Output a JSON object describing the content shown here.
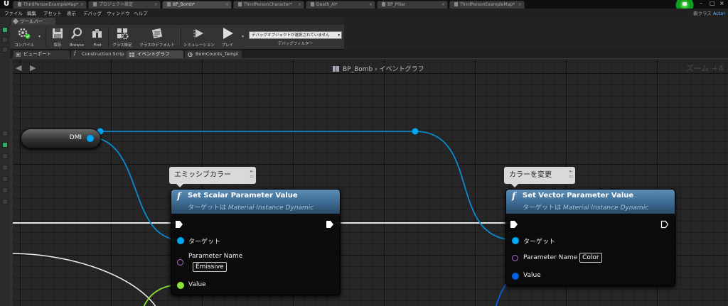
{
  "doc_tabs": [
    {
      "label": "ThirdPersonExampleMap*",
      "active": false
    },
    {
      "label": "プロジェクト設定",
      "active": false
    },
    {
      "label": "BP_Bomb*",
      "active": true
    },
    {
      "label": "ThirdPersonCharacter*",
      "active": false
    },
    {
      "label": "Death_AI*",
      "active": false
    },
    {
      "label": "BP_Pillar",
      "active": false
    },
    {
      "label": "ThirdPersonExampleMap*",
      "active": false
    }
  ],
  "menu": [
    "ファイル",
    "編集",
    "アセット",
    "表示",
    "デバッグ",
    "ウィンドウ",
    "ヘルプ"
  ],
  "parent_class": {
    "label": "親クラス",
    "value": "Actor"
  },
  "toolbar": {
    "tab_label": "ツールバー",
    "buttons": [
      {
        "label": "コンパイル",
        "icon": "compile-icon"
      },
      {
        "label": "保存",
        "icon": "save-icon"
      },
      {
        "label": "Browse",
        "icon": "browse-icon"
      },
      {
        "label": "Find",
        "icon": "find-icon"
      },
      {
        "label": "クラス設定",
        "icon": "class-settings-icon"
      },
      {
        "label": "クラスのデフォルト",
        "icon": "class-defaults-icon"
      },
      {
        "label": "シミュレーション",
        "icon": "simulation-icon"
      },
      {
        "label": "プレイ",
        "icon": "play-icon"
      }
    ],
    "debug_select": "デバッグオブジェクトが選択されていません",
    "debug_caption": "デバッグフィルター"
  },
  "editor_tabs": [
    {
      "label": "ビューポート",
      "active": false,
      "icon": "viewport-icon"
    },
    {
      "label": "Construction Scrip",
      "active": false,
      "icon": "function-icon"
    },
    {
      "label": "イベントグラフ",
      "active": true,
      "icon": "event-graph-icon"
    },
    {
      "label": "BomCounts_Templ",
      "active": false,
      "icon": "timeline-icon"
    }
  ],
  "graph": {
    "breadcrumb_bp": "BP_Bomb",
    "breadcrumb_sep": "›",
    "breadcrumb_graph": "イベントグラフ",
    "zoom": "ズーム +4"
  },
  "variable_node": {
    "label": "DMI"
  },
  "comments": [
    {
      "text": "エミッシブカラー"
    },
    {
      "text": "カラーを変更"
    }
  ],
  "nodes": [
    {
      "title": "Set Scalar Parameter Value",
      "subtitle_prefix": "ターゲットは",
      "subtitle_class": "Material Instance Dynamic",
      "target_label": "ターゲット",
      "param_label": "Parameter Name",
      "param_value": "Emissive",
      "value_label": "Value"
    },
    {
      "title": "Set Vector Parameter Value",
      "subtitle_prefix": "ターゲットは",
      "subtitle_class": "Material Instance Dynamic",
      "target_label": "ターゲット",
      "param_label": "Parameter Name",
      "param_value": "Color",
      "value_label": "Value"
    }
  ],
  "colors": {
    "object_pin": "#00a8f3",
    "exec_pin": "#ffffff",
    "name_pin": "#b46ad6",
    "float_pin": "#8ae234",
    "linear_color_pin": "#0060dd",
    "function_header": "#4a7aa3"
  }
}
